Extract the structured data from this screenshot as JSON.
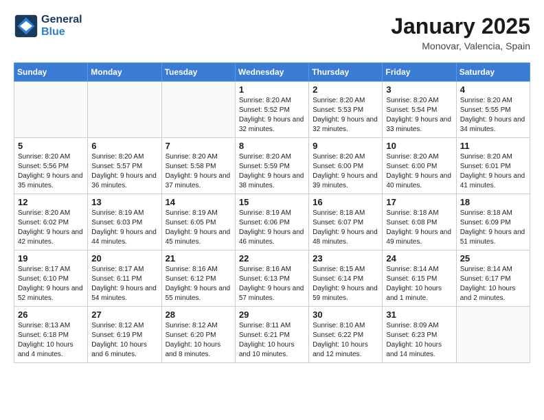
{
  "header": {
    "logo_line1": "General",
    "logo_line2": "Blue",
    "month": "January 2025",
    "location": "Monovar, Valencia, Spain"
  },
  "weekdays": [
    "Sunday",
    "Monday",
    "Tuesday",
    "Wednesday",
    "Thursday",
    "Friday",
    "Saturday"
  ],
  "weeks": [
    [
      {
        "day": "",
        "info": ""
      },
      {
        "day": "",
        "info": ""
      },
      {
        "day": "",
        "info": ""
      },
      {
        "day": "1",
        "info": "Sunrise: 8:20 AM\nSunset: 5:52 PM\nDaylight: 9 hours and 32 minutes."
      },
      {
        "day": "2",
        "info": "Sunrise: 8:20 AM\nSunset: 5:53 PM\nDaylight: 9 hours and 32 minutes."
      },
      {
        "day": "3",
        "info": "Sunrise: 8:20 AM\nSunset: 5:54 PM\nDaylight: 9 hours and 33 minutes."
      },
      {
        "day": "4",
        "info": "Sunrise: 8:20 AM\nSunset: 5:55 PM\nDaylight: 9 hours and 34 minutes."
      }
    ],
    [
      {
        "day": "5",
        "info": "Sunrise: 8:20 AM\nSunset: 5:56 PM\nDaylight: 9 hours and 35 minutes."
      },
      {
        "day": "6",
        "info": "Sunrise: 8:20 AM\nSunset: 5:57 PM\nDaylight: 9 hours and 36 minutes."
      },
      {
        "day": "7",
        "info": "Sunrise: 8:20 AM\nSunset: 5:58 PM\nDaylight: 9 hours and 37 minutes."
      },
      {
        "day": "8",
        "info": "Sunrise: 8:20 AM\nSunset: 5:59 PM\nDaylight: 9 hours and 38 minutes."
      },
      {
        "day": "9",
        "info": "Sunrise: 8:20 AM\nSunset: 6:00 PM\nDaylight: 9 hours and 39 minutes."
      },
      {
        "day": "10",
        "info": "Sunrise: 8:20 AM\nSunset: 6:00 PM\nDaylight: 9 hours and 40 minutes."
      },
      {
        "day": "11",
        "info": "Sunrise: 8:20 AM\nSunset: 6:01 PM\nDaylight: 9 hours and 41 minutes."
      }
    ],
    [
      {
        "day": "12",
        "info": "Sunrise: 8:20 AM\nSunset: 6:02 PM\nDaylight: 9 hours and 42 minutes."
      },
      {
        "day": "13",
        "info": "Sunrise: 8:19 AM\nSunset: 6:03 PM\nDaylight: 9 hours and 44 minutes."
      },
      {
        "day": "14",
        "info": "Sunrise: 8:19 AM\nSunset: 6:05 PM\nDaylight: 9 hours and 45 minutes."
      },
      {
        "day": "15",
        "info": "Sunrise: 8:19 AM\nSunset: 6:06 PM\nDaylight: 9 hours and 46 minutes."
      },
      {
        "day": "16",
        "info": "Sunrise: 8:18 AM\nSunset: 6:07 PM\nDaylight: 9 hours and 48 minutes."
      },
      {
        "day": "17",
        "info": "Sunrise: 8:18 AM\nSunset: 6:08 PM\nDaylight: 9 hours and 49 minutes."
      },
      {
        "day": "18",
        "info": "Sunrise: 8:18 AM\nSunset: 6:09 PM\nDaylight: 9 hours and 51 minutes."
      }
    ],
    [
      {
        "day": "19",
        "info": "Sunrise: 8:17 AM\nSunset: 6:10 PM\nDaylight: 9 hours and 52 minutes."
      },
      {
        "day": "20",
        "info": "Sunrise: 8:17 AM\nSunset: 6:11 PM\nDaylight: 9 hours and 54 minutes."
      },
      {
        "day": "21",
        "info": "Sunrise: 8:16 AM\nSunset: 6:12 PM\nDaylight: 9 hours and 55 minutes."
      },
      {
        "day": "22",
        "info": "Sunrise: 8:16 AM\nSunset: 6:13 PM\nDaylight: 9 hours and 57 minutes."
      },
      {
        "day": "23",
        "info": "Sunrise: 8:15 AM\nSunset: 6:14 PM\nDaylight: 9 hours and 59 minutes."
      },
      {
        "day": "24",
        "info": "Sunrise: 8:14 AM\nSunset: 6:15 PM\nDaylight: 10 hours and 1 minute."
      },
      {
        "day": "25",
        "info": "Sunrise: 8:14 AM\nSunset: 6:17 PM\nDaylight: 10 hours and 2 minutes."
      }
    ],
    [
      {
        "day": "26",
        "info": "Sunrise: 8:13 AM\nSunset: 6:18 PM\nDaylight: 10 hours and 4 minutes."
      },
      {
        "day": "27",
        "info": "Sunrise: 8:12 AM\nSunset: 6:19 PM\nDaylight: 10 hours and 6 minutes."
      },
      {
        "day": "28",
        "info": "Sunrise: 8:12 AM\nSunset: 6:20 PM\nDaylight: 10 hours and 8 minutes."
      },
      {
        "day": "29",
        "info": "Sunrise: 8:11 AM\nSunset: 6:21 PM\nDaylight: 10 hours and 10 minutes."
      },
      {
        "day": "30",
        "info": "Sunrise: 8:10 AM\nSunset: 6:22 PM\nDaylight: 10 hours and 12 minutes."
      },
      {
        "day": "31",
        "info": "Sunrise: 8:09 AM\nSunset: 6:23 PM\nDaylight: 10 hours and 14 minutes."
      },
      {
        "day": "",
        "info": ""
      }
    ]
  ]
}
